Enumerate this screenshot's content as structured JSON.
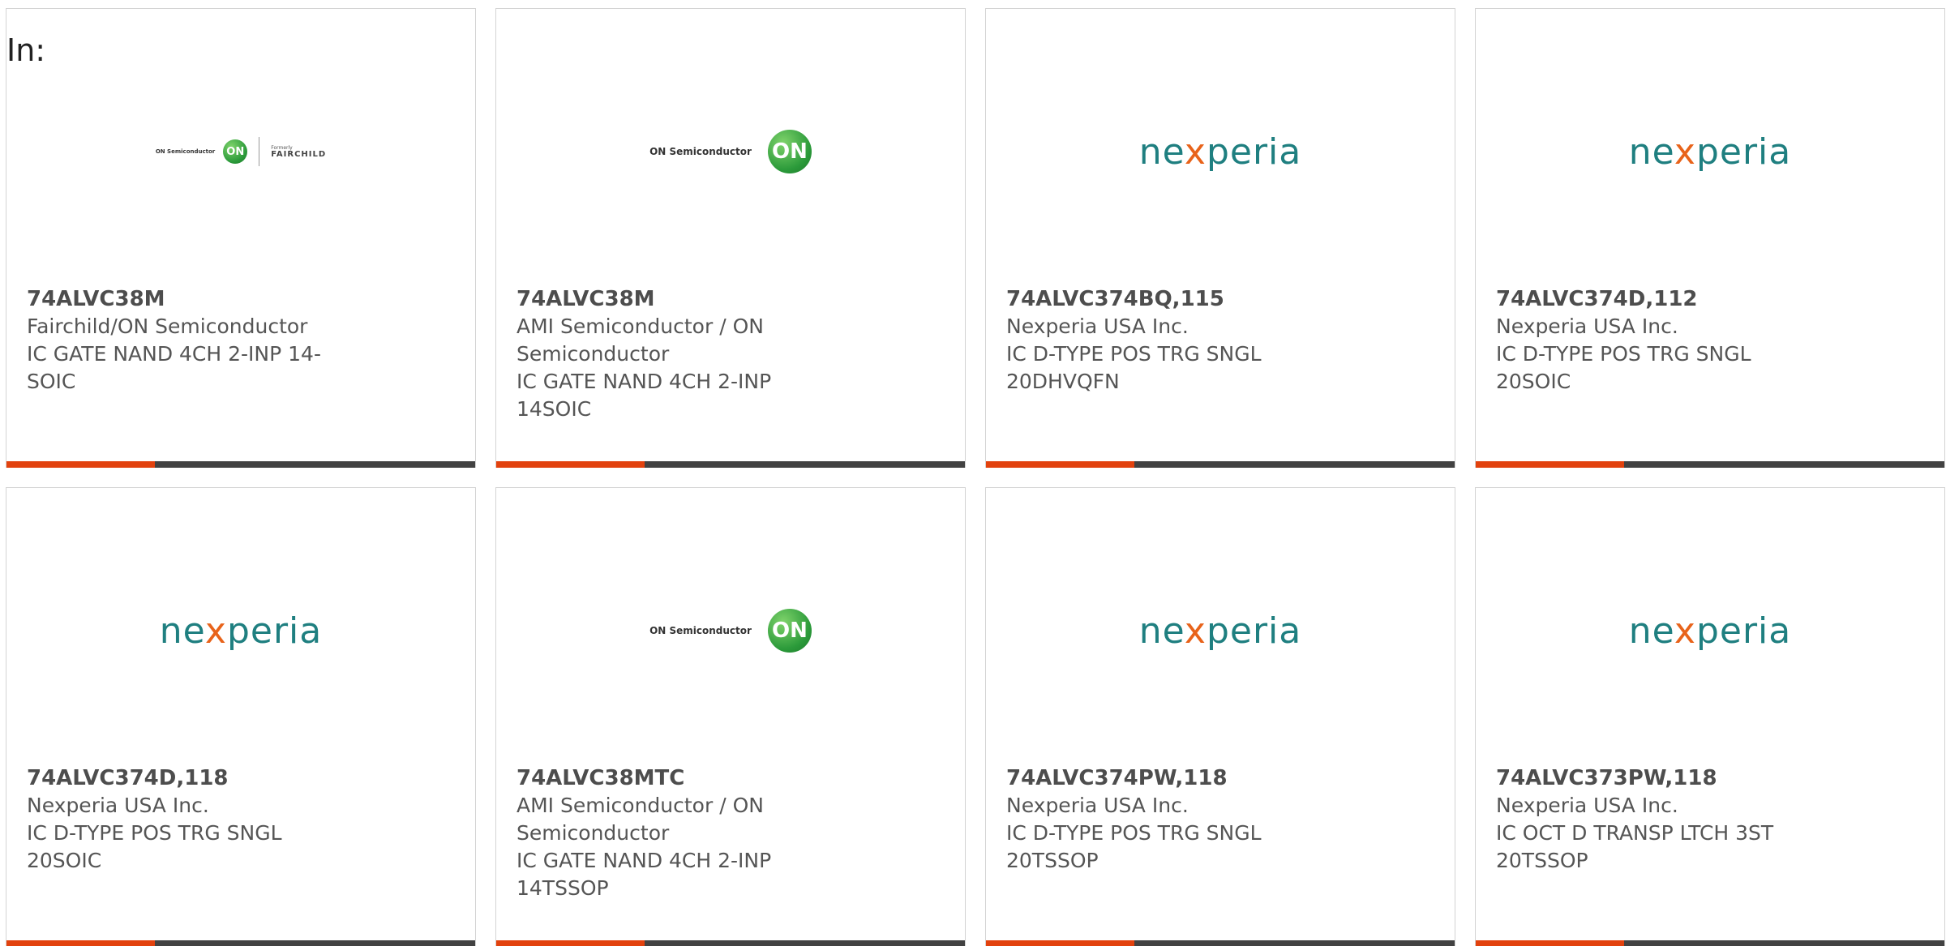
{
  "header": {
    "in_label": "In:"
  },
  "products": [
    {
      "logo": "on-fairchild-logo",
      "logo_text": {
        "on": "ON Semiconductor",
        "formerly": "Formerly",
        "fairchild": "FAIRCHILD"
      },
      "part": "74ALVC38M",
      "manufacturer": "Fairchild/ON Semiconductor",
      "description": "IC GATE NAND 4CH 2-INP 14-SOIC"
    },
    {
      "logo": "on-semiconductor-logo",
      "logo_text": {
        "on": "ON Semiconductor",
        "mark": "ON"
      },
      "part": "74ALVC38M",
      "manufacturer": "AMI Semiconductor / ON Semiconductor",
      "description": "IC GATE NAND 4CH 2-INP 14SOIC"
    },
    {
      "logo": "nexperia-logo",
      "logo_text": {
        "a": "ne",
        "x": "x",
        "b": "peria"
      },
      "part": "74ALVC374BQ,115",
      "manufacturer": "Nexperia USA Inc.",
      "description": "IC D-TYPE POS TRG SNGL 20DHVQFN"
    },
    {
      "logo": "nexperia-logo",
      "logo_text": {
        "a": "ne",
        "x": "x",
        "b": "peria"
      },
      "part": "74ALVC374D,112",
      "manufacturer": "Nexperia USA Inc.",
      "description": "IC D-TYPE POS TRG SNGL 20SOIC"
    },
    {
      "logo": "nexperia-logo",
      "logo_text": {
        "a": "ne",
        "x": "x",
        "b": "peria"
      },
      "part": "74ALVC374D,118",
      "manufacturer": "Nexperia USA Inc.",
      "description": "IC D-TYPE POS TRG SNGL 20SOIC"
    },
    {
      "logo": "on-semiconductor-logo",
      "logo_text": {
        "on": "ON Semiconductor",
        "mark": "ON"
      },
      "part": "74ALVC38MTC",
      "manufacturer": "AMI Semiconductor / ON Semiconductor",
      "description": "IC GATE NAND 4CH 2-INP 14TSSOP"
    },
    {
      "logo": "nexperia-logo",
      "logo_text": {
        "a": "ne",
        "x": "x",
        "b": "peria"
      },
      "part": "74ALVC374PW,118",
      "manufacturer": "Nexperia USA Inc.",
      "description": "IC D-TYPE POS TRG SNGL 20TSSOP"
    },
    {
      "logo": "nexperia-logo",
      "logo_text": {
        "a": "ne",
        "x": "x",
        "b": "peria"
      },
      "part": "74ALVC373PW,118",
      "manufacturer": "Nexperia USA Inc.",
      "description": "IC OCT D TRANSP LTCH 3ST 20TSSOP"
    }
  ],
  "colors": {
    "accent": "#e2420e",
    "bar": "#424242",
    "nexperia_teal": "#1f7f80",
    "nexperia_x": "#e8631a",
    "on_green": "#2b9a3a"
  }
}
